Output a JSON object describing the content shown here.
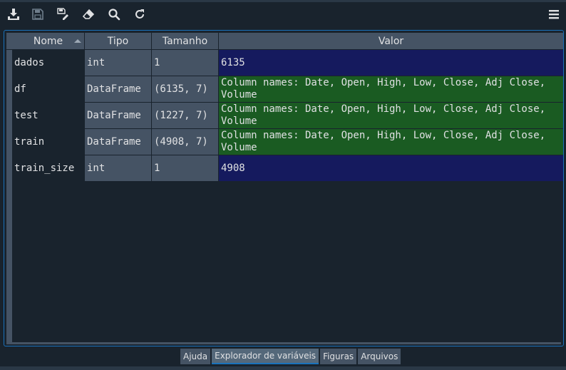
{
  "toolbar": {
    "icons": [
      "import-data-icon",
      "save-icon",
      "save-as-icon",
      "eraser-icon",
      "search-icon",
      "refresh-icon",
      "hamburger-menu-icon"
    ]
  },
  "table": {
    "headers": {
      "name": "Nome",
      "type": "Tipo",
      "size": "Tamanho",
      "value": "Valor"
    },
    "rows": [
      {
        "name": "dados",
        "type": "int",
        "size": "1",
        "value": "6135",
        "kind": "number"
      },
      {
        "name": "df",
        "type": "DataFrame",
        "size": "(6135, 7)",
        "value": "Column names: Date, Open, High, Low, Close, Adj Close, Volume",
        "kind": "dataframe"
      },
      {
        "name": "test",
        "type": "DataFrame",
        "size": "(1227, 7)",
        "value": "Column names: Date, Open, High, Low, Close, Adj Close, Volume",
        "kind": "dataframe"
      },
      {
        "name": "train",
        "type": "DataFrame",
        "size": "(4908, 7)",
        "value": "Column names: Date, Open, High, Low, Close, Adj Close, Volume",
        "kind": "dataframe"
      },
      {
        "name": "train_size",
        "type": "int",
        "size": "1",
        "value": "4908",
        "kind": "number"
      }
    ]
  },
  "tabs": [
    {
      "label": "Ajuda",
      "active": false
    },
    {
      "label": "Explorador de variáveis",
      "active": true
    },
    {
      "label": "Figuras",
      "active": false
    },
    {
      "label": "Arquivos",
      "active": false
    }
  ],
  "colors": {
    "accent": "#1a72bb",
    "number_value_bg": "#151a5e",
    "dataframe_value_bg": "#1a5b22"
  }
}
